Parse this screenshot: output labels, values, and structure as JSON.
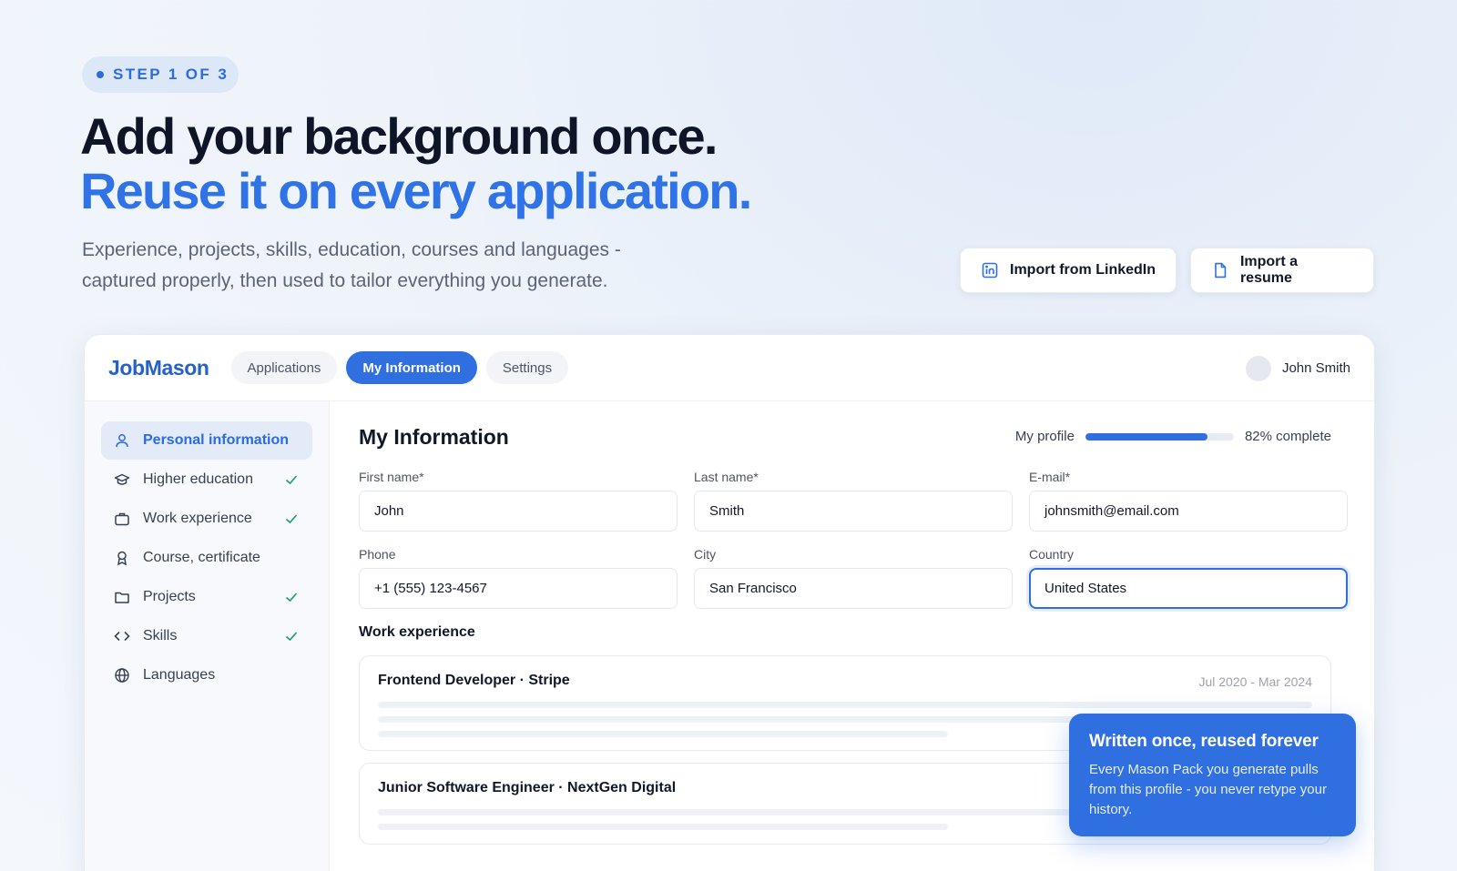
{
  "hero": {
    "step_label": "STEP 1 OF 3",
    "headline_line1": "Add your background once.",
    "headline_line2": "Reuse it on every application.",
    "subtitle_line1": "Experience, projects, skills, education, courses and languages -",
    "subtitle_line2": "captured properly, then used to tailor everything you generate.",
    "import_linkedin": "Import from LinkedIn",
    "import_resume": "Import a resume"
  },
  "app": {
    "logo": "JobMason",
    "tabs": [
      {
        "label": "Applications",
        "active": false
      },
      {
        "label": "My Information",
        "active": true
      },
      {
        "label": "Settings",
        "active": false
      }
    ],
    "user_name": "John Smith"
  },
  "sidebar": {
    "items": [
      {
        "label": "Personal information",
        "icon": "user-icon",
        "active": true,
        "done": false
      },
      {
        "label": "Higher education",
        "icon": "graduation-cap-icon",
        "active": false,
        "done": true
      },
      {
        "label": "Work experience",
        "icon": "briefcase-icon",
        "active": false,
        "done": true
      },
      {
        "label": "Course, certificate",
        "icon": "award-icon",
        "active": false,
        "done": false
      },
      {
        "label": "Projects",
        "icon": "folder-icon",
        "active": false,
        "done": true
      },
      {
        "label": "Skills",
        "icon": "code-icon",
        "active": false,
        "done": true
      },
      {
        "label": "Languages",
        "icon": "globe-icon",
        "active": false,
        "done": false
      }
    ]
  },
  "main": {
    "title": "My Information",
    "progress_label": "My profile",
    "progress_value": 0.82,
    "progress_text": "82% complete",
    "fields": {
      "first_name": {
        "label": "First name*",
        "value": "John"
      },
      "last_name": {
        "label": "Last name*",
        "value": "Smith"
      },
      "email": {
        "label": "E-mail*",
        "value": "johnsmith@email.com"
      },
      "phone": {
        "label": "Phone",
        "value": "+1 (555) 123-4567"
      },
      "city": {
        "label": "City",
        "value": "San Francisco"
      },
      "country": {
        "label": "Country",
        "value": "United States"
      }
    },
    "work_section_label": "Work experience",
    "work": [
      {
        "role": "Frontend Developer · Stripe",
        "dates": "Jul 2020 - Mar 2024"
      },
      {
        "role": "Junior Software Engineer · NextGen Digital",
        "dates": ""
      }
    ]
  },
  "callout": {
    "title": "Written once, reused forever",
    "body": "Every Mason Pack you generate pulls from this profile - you never retype your history."
  },
  "colors": {
    "accent": "#2f6fe0",
    "logo": "#2561c8",
    "check": "#22a06b"
  }
}
